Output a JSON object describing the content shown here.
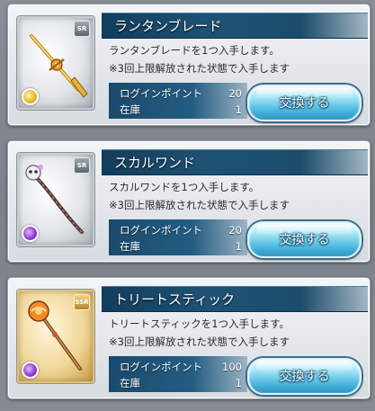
{
  "items": [
    {
      "name": "ランタンブレード",
      "description_line1": "ランタンブレードを1つ入手します。",
      "description_line2": "※3回上限解放された状態で入手します",
      "cost_label": "ログインポイント",
      "cost_value": "20",
      "stock_label": "在庫",
      "stock_value": "1",
      "button_label": "交換する",
      "rarity": "SR",
      "element": "light",
      "icon": "sword-icon"
    },
    {
      "name": "スカルワンド",
      "description_line1": "スカルワンドを1つ入手します。",
      "description_line2": "※3回上限解放された状態で入手します",
      "cost_label": "ログインポイント",
      "cost_value": "20",
      "stock_label": "在庫",
      "stock_value": "1",
      "button_label": "交換する",
      "rarity": "SR",
      "element": "dark",
      "icon": "wand-icon"
    },
    {
      "name": "トリートスティック",
      "description_line1": "トリートスティックを1つ入手します。",
      "description_line2": "※3回上限解放された状態で入手します",
      "cost_label": "ログインポイント",
      "cost_value": "100",
      "stock_label": "在庫",
      "stock_value": "1",
      "button_label": "交換する",
      "rarity": "SSR",
      "element": "dark",
      "icon": "staff-icon"
    }
  ],
  "colors": {
    "title_bar": "#1e5274",
    "button": "#4fbbe0",
    "panel": "#e3e7eb"
  }
}
